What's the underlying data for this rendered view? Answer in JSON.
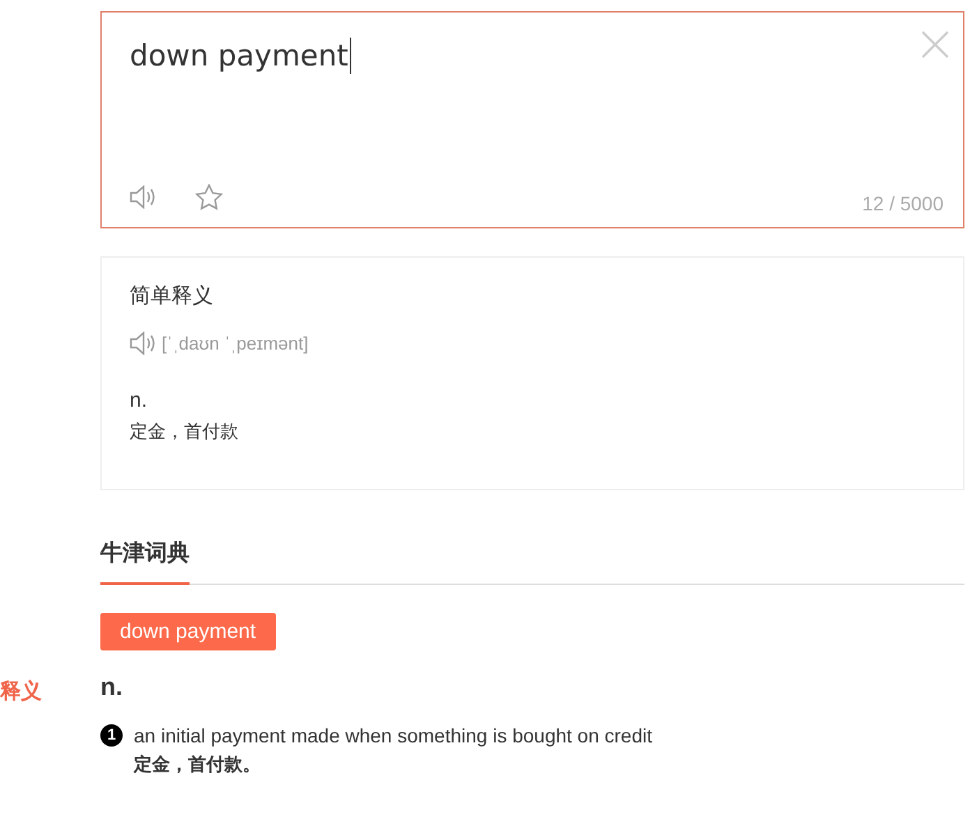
{
  "input": {
    "value": "down payment",
    "counter": "12 / 5000"
  },
  "simple_card": {
    "title": "简单释义",
    "phonetic": "[ˈˌdaʊn ˈˌpeɪmənt]",
    "pos": "n.",
    "meaning": "定金，首付款"
  },
  "side_nav": {
    "label": "释义",
    "selected": true
  },
  "tabs": [
    {
      "label": "牛津词典",
      "selected": true
    }
  ],
  "entry": {
    "headword": "down payment",
    "pos": "n.",
    "senses": [
      {
        "number": "1",
        "definition": "an initial payment made when something is bought on credit",
        "translation": "定金，首付款。"
      }
    ]
  }
}
